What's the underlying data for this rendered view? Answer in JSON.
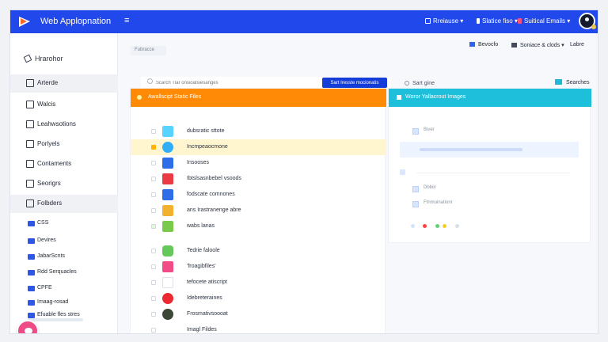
{
  "topbar": {
    "title": "Web Applopnation",
    "menu_icon": "≡",
    "items": [
      {
        "label": "Rreiause ▾",
        "icon": "square-icon",
        "color": "#ffffff"
      },
      {
        "label": "Slatice fiso ▾",
        "icon": "status-icon",
        "color": "#ffffff"
      },
      {
        "label": "Suitical Emails ▾",
        "icon": "mail-icon",
        "color": "#ff4f7d"
      }
    ],
    "colors": {
      "bar": "#2148ea"
    }
  },
  "sidebar": {
    "header": "Hrarohor",
    "items": [
      {
        "label": "Arterde",
        "icon": "doc-icon",
        "active": true
      },
      {
        "label": "Walcis",
        "icon": "edit-icon",
        "active": false
      },
      {
        "label": "Leahwsotions",
        "icon": "layers-icon",
        "active": false
      },
      {
        "label": "Porlyels",
        "icon": "image-icon",
        "active": false
      },
      {
        "label": "Contaments",
        "icon": "share-icon",
        "active": false
      },
      {
        "label": "Seorigrs",
        "icon": "settings-icon",
        "active": false
      },
      {
        "label": "Folbders",
        "icon": "folder-icon",
        "active": true
      }
    ],
    "folders": [
      {
        "label": "CSS",
        "icon": "folder-blue-icon"
      },
      {
        "label": "Devires",
        "icon": "folder-blue-icon"
      },
      {
        "label": "JabarScnts",
        "icon": "folder-blue-icon"
      },
      {
        "label": "Rdd Serquacles",
        "icon": "folder-blue-icon"
      },
      {
        "label": "CPFE",
        "icon": "folder-blue-icon"
      },
      {
        "label": "Imaag-rosad",
        "icon": "folder-blue-icon"
      },
      {
        "label": "Efuable fles stres",
        "icon": "folder-blue-icon"
      }
    ]
  },
  "toolbar": {
    "chip_label": "Fubracce",
    "right_items": [
      {
        "label": "Bevocfo",
        "icon": "blue-block-icon"
      },
      {
        "label": "Soniace & clods ▾",
        "icon": "notes-icon"
      },
      {
        "label": "Labre",
        "icon": "none"
      }
    ]
  },
  "actions": {
    "search_placeholder": "Scarch Tlar onsioatsiesanges",
    "primary_button": "Sart Iresste mocionatis",
    "sort_label": "Sart gine",
    "search_pill": "Searches"
  },
  "left_panel": {
    "header": "Awallscipt Static Files",
    "rows": [
      {
        "label": "dubsratic sttote",
        "icon_color": "#56d4ff",
        "highlight": false
      },
      {
        "label": "Incmpeaocmone",
        "icon_color": "#31aef8",
        "highlight": true
      },
      {
        "label": "Insooses",
        "icon_color": "#2d6ee8",
        "highlight": false
      },
      {
        "label": "Ibtslsasnbebel vsoods",
        "icon_color": "#ec3a45",
        "highlight": false
      },
      {
        "label": "fodscate comnones",
        "icon_color": "#2f6de8",
        "highlight": false
      },
      {
        "label": "ans Irastranenge abre",
        "icon_color": "#f2b12f",
        "highlight": false
      },
      {
        "label": "wabs lanas",
        "icon_color": "#79c94a",
        "highlight": false
      },
      {
        "label": "Tedrie faloole",
        "icon_color": "#65c85a",
        "highlight": false
      },
      {
        "label": "'froagibfiles'",
        "icon_color": "#f24b87",
        "highlight": false
      },
      {
        "label": "tefocete atiscript",
        "icon_color": "#ffffff",
        "highlight": false
      },
      {
        "label": "Idebreteraines",
        "icon_color": "#ec2831",
        "highlight": false
      },
      {
        "label": "Frosmativsoooat",
        "icon_color": "#3d4736",
        "highlight": false
      },
      {
        "label": "Imagl Fildes",
        "icon_color": "#ffffff",
        "highlight": false
      }
    ]
  },
  "right_panel": {
    "header": "Woror Yallacrout Images",
    "rows": [
      {
        "label": "Biver"
      },
      {
        "label": "Dbbiir"
      },
      {
        "label": "Ftnmuinationr"
      }
    ],
    "dots": [
      "#ff4044",
      "#64d072",
      "#f4d01c"
    ]
  }
}
